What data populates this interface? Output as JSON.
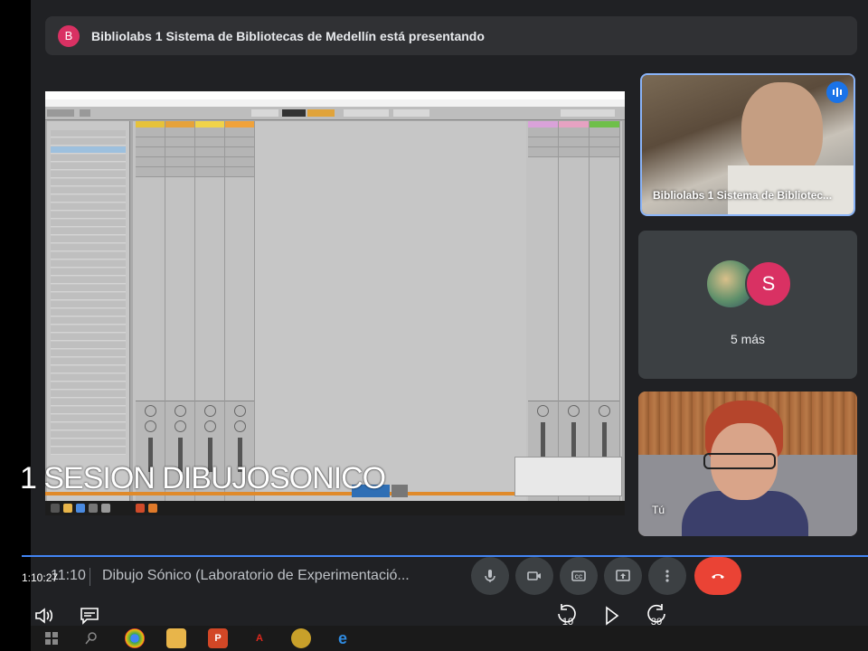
{
  "banner": {
    "avatar_letter": "B",
    "text": "Bibliolabs 1 Sistema de Bibliotecas de Medellín está presentando"
  },
  "shared_screen": {
    "overlay_caption": "1 SESION DIBUJOSONICO"
  },
  "participants": {
    "presenter_name": "Bibliolabs 1 Sistema de Bibliotec...",
    "group_avatar_letter": "S",
    "more_label": "5 más",
    "self_name": "Tú"
  },
  "meeting_bar": {
    "time_left": "1:10:27",
    "clock": "11:10",
    "meeting_name": "Dibujo Sónico (Laboratorio de Experimentació..."
  },
  "player": {
    "rewind_seconds": "10",
    "forward_seconds": "30"
  },
  "colors": {
    "accent_blue": "#4285f4",
    "end_call_red": "#ea4335",
    "avatar_pink": "#d93163"
  },
  "icons": {
    "controls": [
      "microphone-icon",
      "camera-icon",
      "captions-icon",
      "present-icon",
      "more-icon",
      "end-call-icon"
    ],
    "player": [
      "volume-icon",
      "subtitles-icon",
      "rewind-icon",
      "play-icon",
      "forward-icon"
    ],
    "taskbar": [
      "windows-start-icon",
      "search-icon",
      "chrome-icon",
      "file-explorer-icon",
      "powerpoint-icon",
      "acrobat-icon",
      "app-icon",
      "edge-icon"
    ]
  }
}
